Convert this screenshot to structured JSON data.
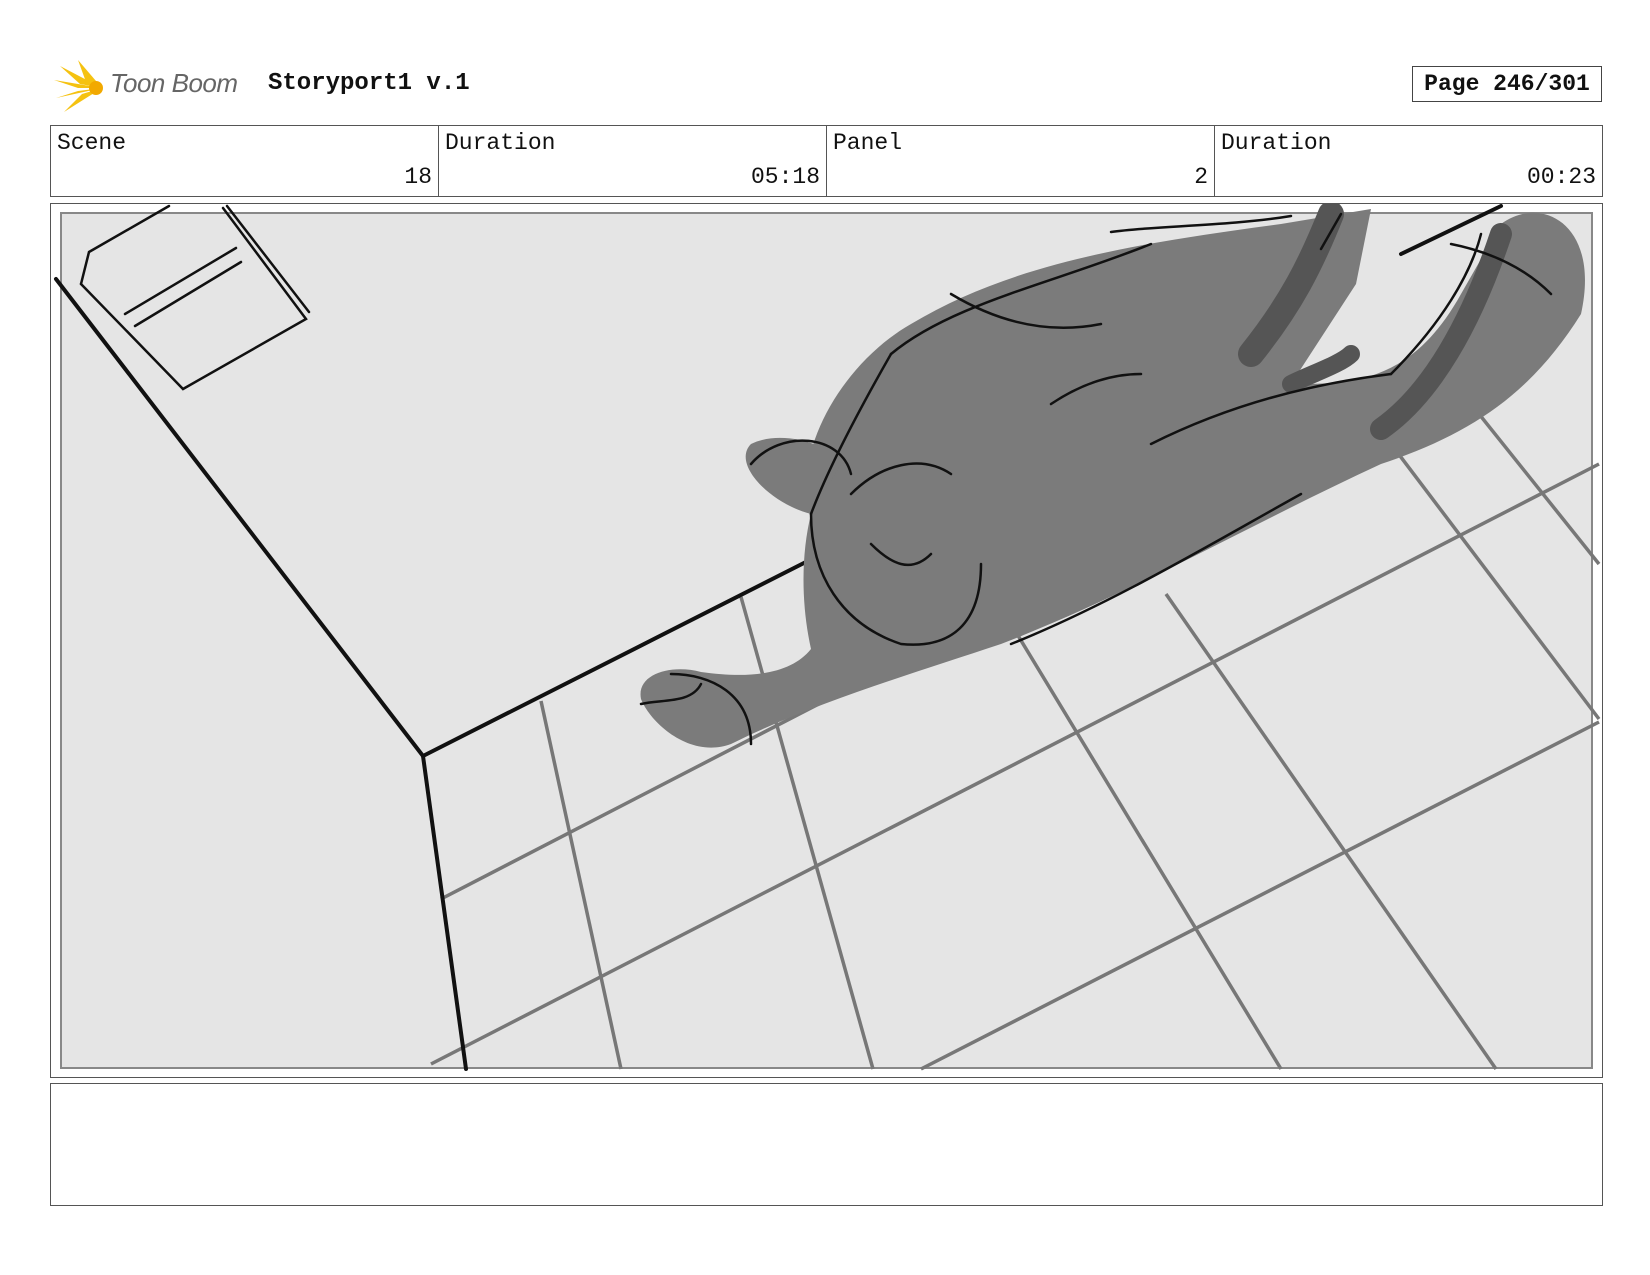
{
  "header": {
    "logo_text": "Toon Boom",
    "project_title": "Storyport1 v.1",
    "page_label": "Page 246/301"
  },
  "info": {
    "scene_label": "Scene",
    "scene_value": "18",
    "scene_duration_label": "Duration",
    "scene_duration_value": "05:18",
    "panel_label": "Panel",
    "panel_value": "2",
    "panel_duration_label": "Duration",
    "panel_duration_value": "00:23"
  },
  "notes": {
    "text": ""
  }
}
